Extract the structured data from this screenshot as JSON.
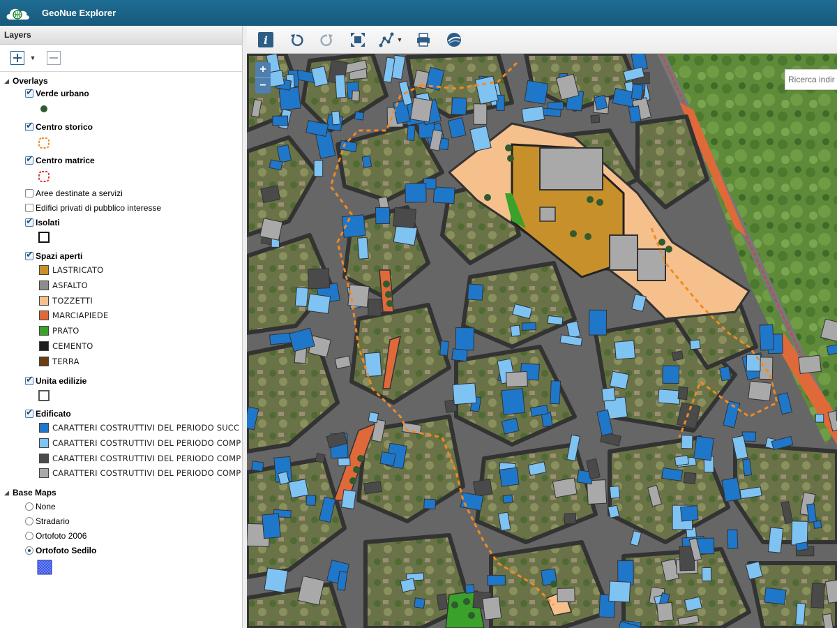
{
  "app": {
    "title": "GeoNue Explorer"
  },
  "layers_panel": {
    "title": "Layers",
    "overlays": {
      "label": "Overlays",
      "items": [
        {
          "label": "Verde urbano",
          "checked": true
        },
        {
          "label": "Centro storico",
          "checked": true
        },
        {
          "label": "Centro matrice",
          "checked": true
        },
        {
          "label": "Aree destinate a servizi",
          "checked": false
        },
        {
          "label": "Edifici privati di pubblico interesse",
          "checked": false
        },
        {
          "label": "Isolati",
          "checked": true
        },
        {
          "label": "Spazi aperti",
          "checked": true
        },
        {
          "label": "Unita edilizie",
          "checked": true
        },
        {
          "label": "Edificato",
          "checked": true
        }
      ]
    },
    "spazi_aperti_legend": [
      {
        "label": "LASTRICATO",
        "color": "#c8902a"
      },
      {
        "label": "ASFALTO",
        "color": "#8c8c8c"
      },
      {
        "label": "TOZZETTI",
        "color": "#f6c08d"
      },
      {
        "label": "MARCIAPIEDE",
        "color": "#e0693a"
      },
      {
        "label": "PRATO",
        "color": "#3aa12a"
      },
      {
        "label": "CEMENTO",
        "color": "#1f1f1f"
      },
      {
        "label": "TERRA",
        "color": "#6a3e12"
      }
    ],
    "edificato_legend": [
      {
        "label": "CARATTERI COSTRUTTIVI DEL PERIODO SUCC",
        "color": "#1f77c9"
      },
      {
        "label": "CARATTERI COSTRUTTIVI DEL PERIODO COMP",
        "color": "#7fc3f3"
      },
      {
        "label": "CARATTERI COSTRUTTIVI DEL PERIODO COMP",
        "color": "#4a4a4a"
      },
      {
        "label": "CARATTERI COSTRUTTIVI DEL PERIODO COMP",
        "color": "#a9a9a9"
      }
    ],
    "base_maps": {
      "label": "Base Maps",
      "items": [
        {
          "label": "None",
          "selected": false
        },
        {
          "label": "Stradario",
          "selected": false
        },
        {
          "label": "Ortofoto 2006",
          "selected": false
        },
        {
          "label": "Ortofoto Sedilo",
          "selected": true
        }
      ]
    }
  },
  "map": {
    "search_placeholder": "Ricerca indir",
    "zoom_in": "+",
    "zoom_out": "−"
  }
}
